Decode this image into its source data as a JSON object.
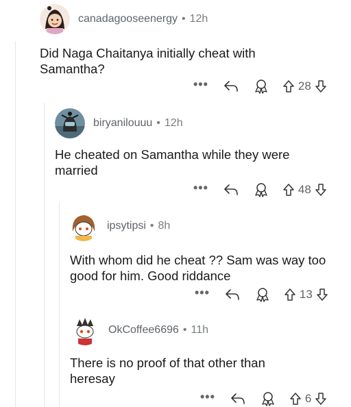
{
  "comments": [
    {
      "username": "canadagooseenergy",
      "separator": "•",
      "time": "12h",
      "text": "Did Naga Chaitanya initially cheat with Samantha?",
      "score": "28",
      "more": "•••"
    },
    {
      "username": "biryanilouuu",
      "separator": "•",
      "time": "12h",
      "text": "He cheated on Samantha while they were married",
      "score": "48",
      "more": "•••"
    },
    {
      "username": "ipsytipsi",
      "separator": "•",
      "time": "8h",
      "text": "With whom did he cheat ?? Sam was way too good for him. Good riddance",
      "score": "13",
      "more": "•••"
    },
    {
      "username": "OkCoffee6696",
      "separator": "•",
      "time": "11h",
      "text": "There is no proof of that other than heresay",
      "score": "6",
      "more": "•••"
    }
  ],
  "icons": {
    "more": "more-options-icon",
    "reply": "reply-arrow-icon",
    "award": "award-ribbon-icon",
    "upvote": "upvote-arrow-icon",
    "downvote": "downvote-arrow-icon"
  },
  "colors": {
    "text": "#1a1a1b",
    "meta": "#787c7e",
    "thread_line": "#e6e6e6"
  }
}
